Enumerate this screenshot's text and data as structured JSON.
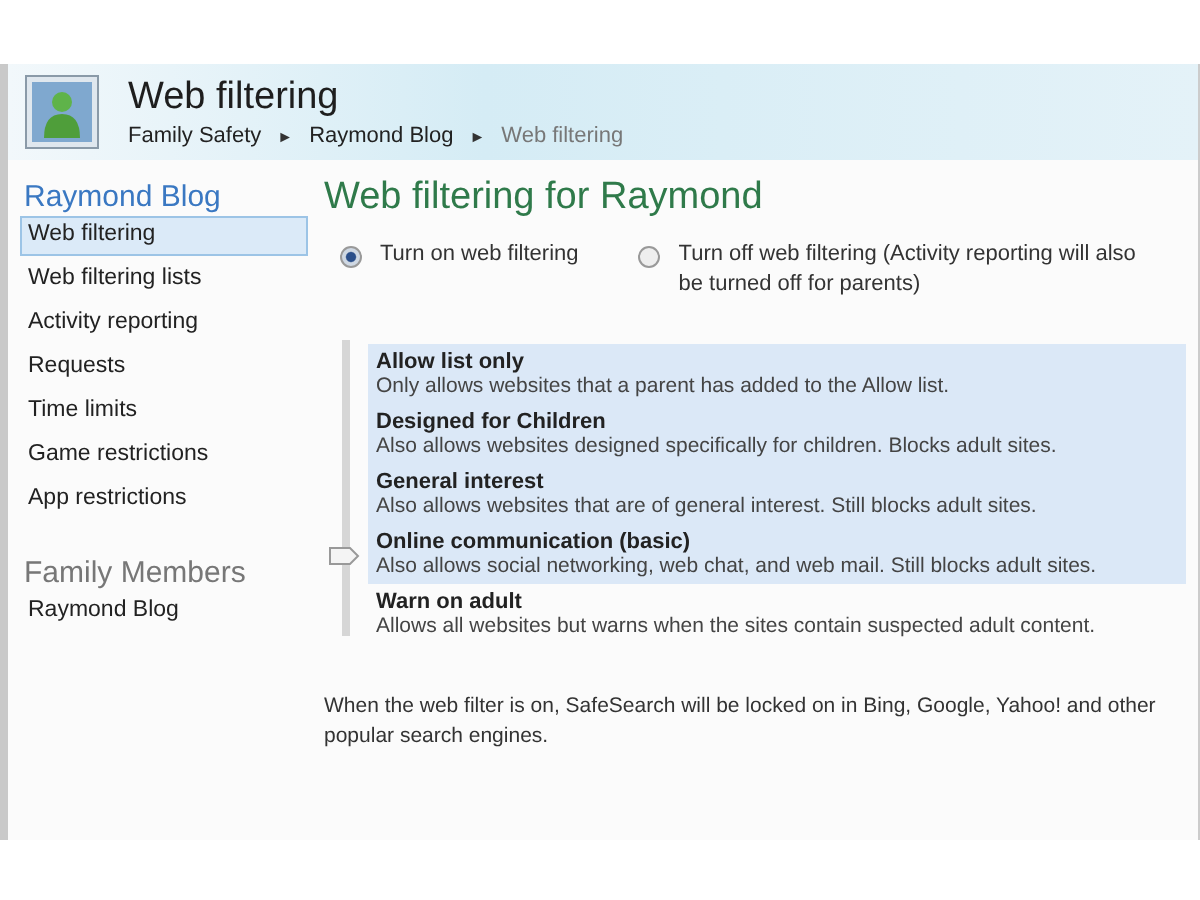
{
  "header": {
    "title": "Web filtering",
    "breadcrumb": [
      {
        "label": "Family Safety",
        "current": false
      },
      {
        "label": "Raymond Blog",
        "current": false
      },
      {
        "label": "Web filtering",
        "current": true
      }
    ],
    "separator": "►"
  },
  "sidebar": {
    "heading": "Raymond Blog",
    "items": [
      {
        "label": "Web filtering",
        "selected": true
      },
      {
        "label": "Web filtering lists",
        "selected": false
      },
      {
        "label": "Activity reporting",
        "selected": false
      },
      {
        "label": "Requests",
        "selected": false
      },
      {
        "label": "Time limits",
        "selected": false
      },
      {
        "label": "Game restrictions",
        "selected": false
      },
      {
        "label": "App restrictions",
        "selected": false
      }
    ],
    "members_heading": "Family Members",
    "members": [
      "Raymond Blog"
    ]
  },
  "main": {
    "title": "Web filtering for Raymond",
    "options": [
      {
        "label": "Turn on web filtering",
        "selected": true
      },
      {
        "label": "Turn off web filtering (Activity reporting will also be turned off for parents)",
        "selected": false
      }
    ],
    "levels": [
      {
        "name": "Allow list only",
        "description": "Only allows websites that a parent has added to the Allow list.",
        "selected": false
      },
      {
        "name": "Designed for Children",
        "description": "Also allows websites designed specifically for children. Blocks adult sites.",
        "selected": false
      },
      {
        "name": "General interest",
        "description": "Also allows websites that are of general interest. Still blocks adult sites.",
        "selected": false
      },
      {
        "name": "Online communication (basic)",
        "description": "Also allows social networking, web chat, and web mail. Still blocks adult sites.",
        "selected": true
      },
      {
        "name": "Warn on adult",
        "description": "Allows all websites but warns when the sites contain suspected adult content.",
        "selected": false
      }
    ],
    "note": "When the web filter is on, SafeSearch will be locked on in Bing, Google, Yahoo! and other popular search engines."
  }
}
